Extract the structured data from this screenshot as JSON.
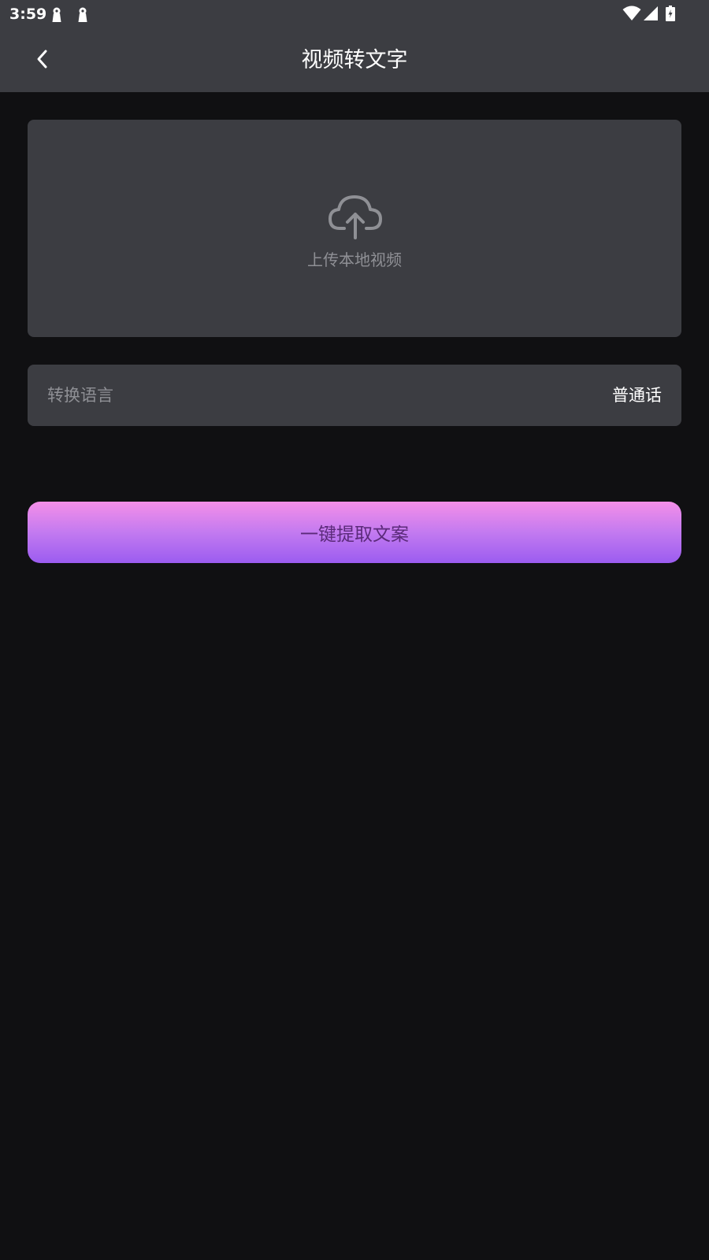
{
  "status_bar": {
    "time": "3:59",
    "left_icons": [
      "notification-icon",
      "notification-icon"
    ],
    "right_icons": [
      "wifi-icon",
      "signal-icon",
      "battery-charging-icon"
    ]
  },
  "header": {
    "back_icon": "chevron-left-icon",
    "title": "视频转文字"
  },
  "upload": {
    "icon": "cloud-upload-icon",
    "label": "上传本地视频"
  },
  "language": {
    "label": "转换语言",
    "value": "普通话"
  },
  "action": {
    "label": "一键提取文案"
  },
  "colors": {
    "background": "#101012",
    "surface": "#3c3d42",
    "muted_text": "#8f9095",
    "button_gradient_top": "#f48fe8",
    "button_gradient_bottom": "#9b5cf0",
    "button_text": "#5b2a7a"
  }
}
